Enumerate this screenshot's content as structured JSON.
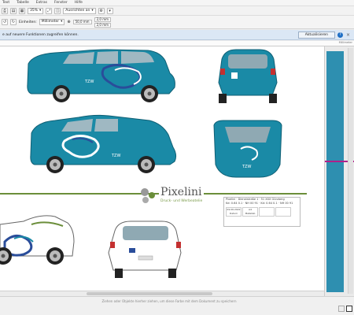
{
  "app": {
    "menu": [
      "Text",
      "Tabelle",
      "Extras",
      "Fenster",
      "Hilfe"
    ],
    "zoom": "35%",
    "snap_label": "Ausrichten an",
    "units_label": "Einheiten:",
    "units_value": "Millimeter",
    "nudge_value": "50,0 mm",
    "dup_x": "2,0 mm",
    "dup_y": "2,0 mm"
  },
  "infobar": {
    "message": "e auf neuere Funktionen zugreifen können.",
    "update_button": "Aktualisieren"
  },
  "ruler": {
    "unit_label": "Millimeter"
  },
  "document": {
    "vehicle_text": "TZW",
    "brand_name": "Pixelini",
    "brand_tagline": "Druck- und Werbeatelie",
    "info_table": {
      "header_lines": [
        "Pixelini · Dienststraße 1 · 51 XXX Gürzberg",
        "Kd: 0.64 0.1 · NH 00 91 · Kd: 0.64 0.1 · NH 00 91"
      ],
      "cells": [
        "09.06.2022",
        "A4",
        "",
        ""
      ],
      "cell_labels": [
        "Datum",
        "Maßstab",
        "",
        ""
      ]
    }
  },
  "status": {
    "hint": "Ziehen oder Objekte hierher ziehen, um diese Farbe mit dem Dokument zu speichern"
  },
  "colors": {
    "car_body": "#1a8aa6",
    "accent_green": "#6b8e3a",
    "swatch_blue": "#2e8fb0",
    "guide_magenta": "#b0208a"
  }
}
